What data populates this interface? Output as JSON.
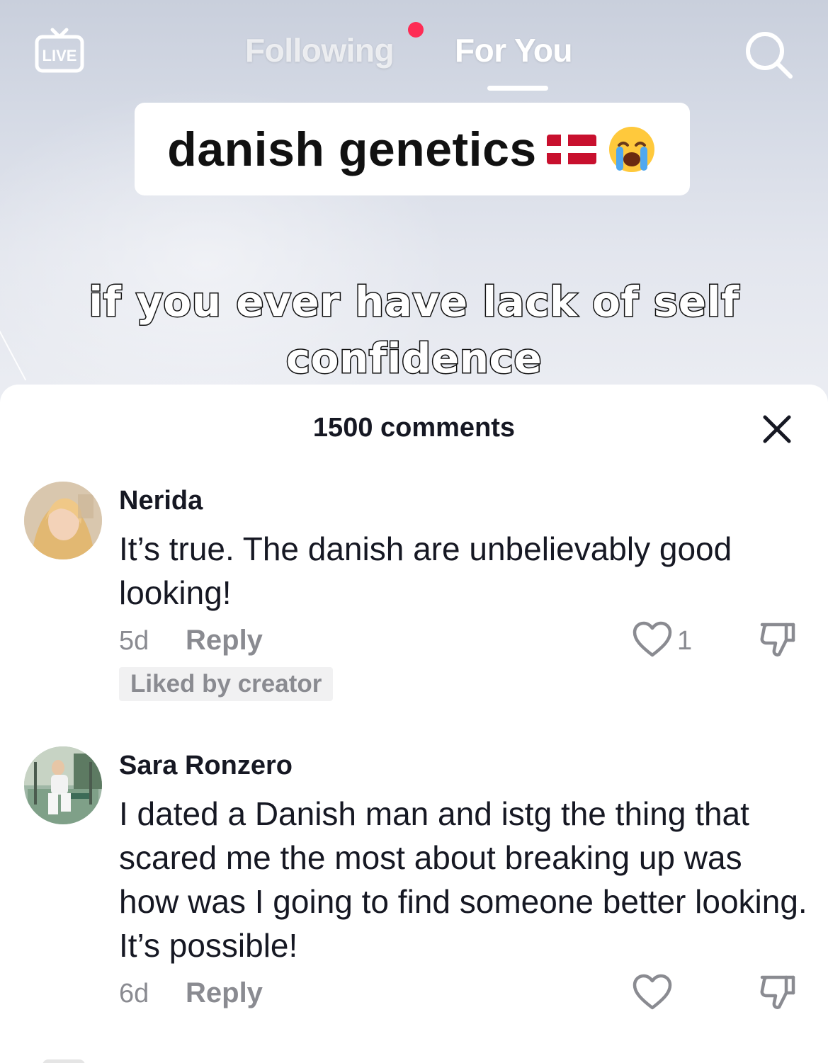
{
  "nav": {
    "live_label": "LIVE",
    "tabs": [
      {
        "label": "Following",
        "active": false,
        "has_notification": true
      },
      {
        "label": "For You",
        "active": true
      }
    ],
    "notification_color": "#fe2c55"
  },
  "video": {
    "title": "danish genetics",
    "title_emojis": [
      "denmark-flag-icon",
      "loudly-crying-face-icon"
    ],
    "caption_line1": "if you ever have lack of self",
    "caption_line2": "confidence"
  },
  "comments_panel": {
    "header": "1500 comments",
    "comments": [
      {
        "username": "Nerida",
        "text": "It’s true. The danish are unbelievably good looking!",
        "age": "5d",
        "reply_label": "Reply",
        "like_count": "1",
        "badge": "Liked by creator"
      },
      {
        "username": "Sara Ronzero",
        "text": "I dated a Danish man and istg the thing that scared me the most about breaking up was how was I going to find someone better looking. It’s possible!",
        "age": "6d",
        "reply_label": "Reply",
        "like_count": ""
      }
    ]
  },
  "colors": {
    "accent": "#fe2c55",
    "text_primary": "#161823",
    "text_secondary": "#8a8b91",
    "badge_bg": "#f1f1f2"
  }
}
